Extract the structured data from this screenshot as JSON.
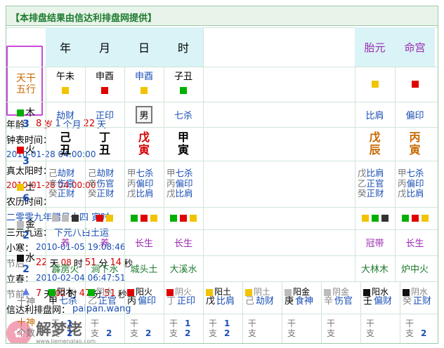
{
  "banner": "【本排盘结果由信达利排盘网提供】",
  "header": {
    "cols": [
      "年",
      "月",
      "日",
      "时"
    ],
    "right": [
      "胎元",
      "命宫"
    ]
  },
  "wuxing_label": [
    "天干",
    "五行"
  ],
  "pillars": [
    {
      "ganzhi": "午未",
      "shishen": "劫财",
      "gan": "己",
      "zhi": "丑",
      "sq": "#f2c400",
      "hidden": [
        [
          "己",
          "劫财"
        ],
        [
          "辛",
          "伤官"
        ],
        [
          "癸",
          "正财"
        ]
      ],
      "sqs": [
        "#bbbbbb",
        "#bbbbbb",
        "#333333"
      ],
      "stage": "养",
      "nayin": "霹雳火"
    },
    {
      "ganzhi": "申酉",
      "shishen": "正印",
      "gan": "丁",
      "zhi": "丑",
      "sq": "#e00000",
      "hidden": [
        [
          "己",
          "劫财"
        ],
        [
          "辛",
          "伤官"
        ],
        [
          "癸",
          "正财"
        ]
      ],
      "sqs": [
        "#e00000",
        "#f2c400"
      ],
      "stage": "养",
      "nayin": "涧下水"
    },
    {
      "ganzhi": "申酉",
      "shishen": "男",
      "gan": "戊",
      "zhi": "寅",
      "sq": "#f2c400",
      "hidden": [
        [
          "甲",
          "七杀"
        ],
        [
          "丙",
          "偏印"
        ],
        [
          "戊",
          "比肩"
        ]
      ],
      "sqs": [
        "#00b000",
        "#e00000",
        "#f2c400"
      ],
      "stage": "长生",
      "nayin": "城头土"
    },
    {
      "ganzhi": "子丑",
      "shishen": "七杀",
      "gan": "甲",
      "zhi": "寅",
      "sq": "#00b000",
      "hidden": [
        [
          "甲",
          "七杀"
        ],
        [
          "丙",
          "偏印"
        ],
        [
          "戊",
          "比肩"
        ]
      ],
      "sqs": [
        "#00b000",
        "#e00000",
        "#f2c400"
      ],
      "stage": "长生",
      "nayin": "大溪水"
    }
  ],
  "extra": [
    {
      "shishen": "比肩",
      "gan": "戊",
      "zhi": "辰",
      "sq": "#f2c400",
      "hidden": [
        [
          "戊",
          "比肩"
        ],
        [
          "乙",
          "正官"
        ],
        [
          "癸",
          "正财"
        ]
      ],
      "sqs": [
        "#f2c400",
        "#00b000",
        "#333333"
      ],
      "stage": "冠带",
      "nayin": "大林木"
    },
    {
      "shishen": "偏印",
      "gan": "丙",
      "zhi": "寅",
      "sq": "#e00000",
      "hidden": [
        [
          "甲",
          "七杀"
        ],
        [
          "丙",
          "偏印"
        ],
        [
          "戊",
          "比肩"
        ]
      ],
      "sqs": [
        "#00b000",
        "#e00000",
        "#f2c400"
      ],
      "stage": "长生",
      "nayin": "炉中火"
    }
  ],
  "elements": [
    {
      "name": "木",
      "count": "3",
      "color": "#00b000"
    },
    {
      "name": "火",
      "count": "3",
      "color": "#e00000"
    },
    {
      "name": "土",
      "count": "6",
      "color": "#f2c400"
    },
    {
      "name": "金",
      "count": "2",
      "color": "#bbbbbb"
    },
    {
      "name": "水",
      "count": "2",
      "color": "#111111"
    }
  ],
  "info": {
    "age_label": "年龄：",
    "age": "8",
    "age_u1": "岁",
    "age_m": "1",
    "age_u2": "个月",
    "age_d": "22",
    "age_u3": "天",
    "clock_label": "钟表时间：",
    "clock": "2010-01-28 04:00:00",
    "solar_label": "真太阳时：",
    "solar": "2010-01-28 04:00:00",
    "lunar_label": "农历时间：",
    "lunar": "二零零九年腊月十四 寅时",
    "sanyuan_label": "三元九运：",
    "sanyuan": "下元八白土运",
    "xiaohan_label": "小寒：",
    "xiaohan": "2010-01-05 19:08:46",
    "after_label": "节后：",
    "after_d": "22",
    "after_du": "天",
    "after_h": "08",
    "after_hu": "时",
    "after_m": "51",
    "after_mu": "分",
    "after_s": "14",
    "after_su": "秒",
    "lichun_label": "立春：",
    "lichun": "2010-02-04 06:47:51",
    "before_label": "节前：",
    "before_d": "7",
    "before_du": "天",
    "before_h": "02",
    "before_hu": "时",
    "before_m": "47",
    "before_mu": "分",
    "before_s": "51",
    "before_su": "秒",
    "site_label": "信达利排盘网：",
    "site": "paipan.wang"
  },
  "shishen_head": [
    "十神",
    "个数"
  ],
  "shishen_arrow": "▲",
  "shishen_label": "十神",
  "shishen_row1": [
    {
      "sq": "#00b000",
      "a": "阳木",
      "b": "甲",
      "c": "七杀",
      "dim": false
    },
    {
      "sq": "#00b000",
      "a": "阴木",
      "b": "乙",
      "c": "正官",
      "dim": true
    },
    {
      "sq": "#e00000",
      "a": "阳火",
      "b": "丙",
      "c": "偏印",
      "dim": false
    },
    {
      "sq": "#e00000",
      "a": "阴火",
      "b": "丁",
      "c": "正印",
      "dim": true
    },
    {
      "sq": "#f2c400",
      "a": "阳土",
      "b": "戊",
      "c": "比肩",
      "dim": false
    },
    {
      "sq": "#f2c400",
      "a": "阴土",
      "b": "己",
      "c": "劫财",
      "dim": true
    },
    {
      "sq": "#bbbbbb",
      "a": "阳金",
      "b": "庚",
      "c": "食神",
      "dim": false
    },
    {
      "sq": "#bbbbbb",
      "a": "阴金",
      "b": "辛",
      "c": "伤官",
      "dim": true
    },
    {
      "sq": "#111111",
      "a": "阳水",
      "b": "壬",
      "c": "偏财",
      "dim": false
    },
    {
      "sq": "#111111",
      "a": "阴水",
      "b": "癸",
      "c": "正财",
      "dim": true
    }
  ],
  "counts": [
    {
      "gan": "1",
      "zhi": "2"
    },
    {
      "gan": "",
      "zhi": "2"
    },
    {
      "gan": "",
      "zhi": "2"
    },
    {
      "gan": "1",
      "zhi": "2"
    },
    {
      "gan": "1",
      "zhi": "2"
    },
    {
      "gan": "",
      "zhi": ""
    },
    {
      "gan": "",
      "zhi": ""
    },
    {
      "gan": "",
      "zhi": ""
    },
    {
      "gan": "",
      "zhi": ""
    },
    {
      "gan": "",
      "zhi": "2"
    }
  ],
  "count_labels": {
    "gan": "干",
    "zhi": "支"
  },
  "watermark": {
    "title": "解梦佬",
    "url": "www.jiemenglao.com"
  }
}
